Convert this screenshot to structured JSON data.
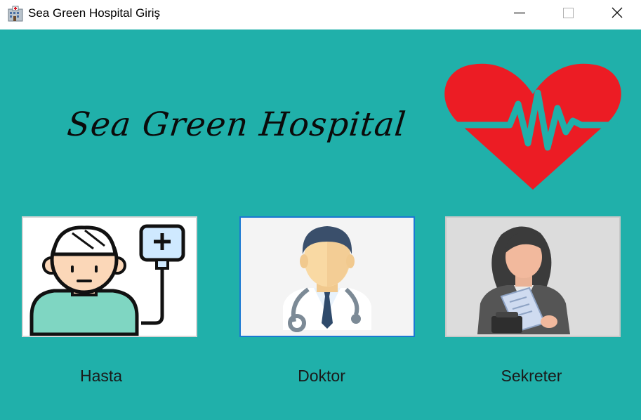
{
  "window": {
    "title": "Sea Green Hospital Giriş",
    "icon": "hospital-app-icon",
    "controls": [
      "minimize-icon",
      "maximize-icon",
      "close-icon"
    ]
  },
  "header": {
    "logo_text": "Sea Green Hospital",
    "heart_icon": "heartbeat-icon"
  },
  "roles": [
    {
      "label": "Hasta",
      "icon": "patient-icon",
      "selected": false
    },
    {
      "label": "Doktor",
      "icon": "doctor-icon",
      "selected": true
    },
    {
      "label": "Sekreter",
      "icon": "secretary-icon",
      "selected": false
    }
  ],
  "colors": {
    "background": "#20b0aa",
    "heart": "#ec1c24",
    "selected_border": "#1a78d2"
  }
}
